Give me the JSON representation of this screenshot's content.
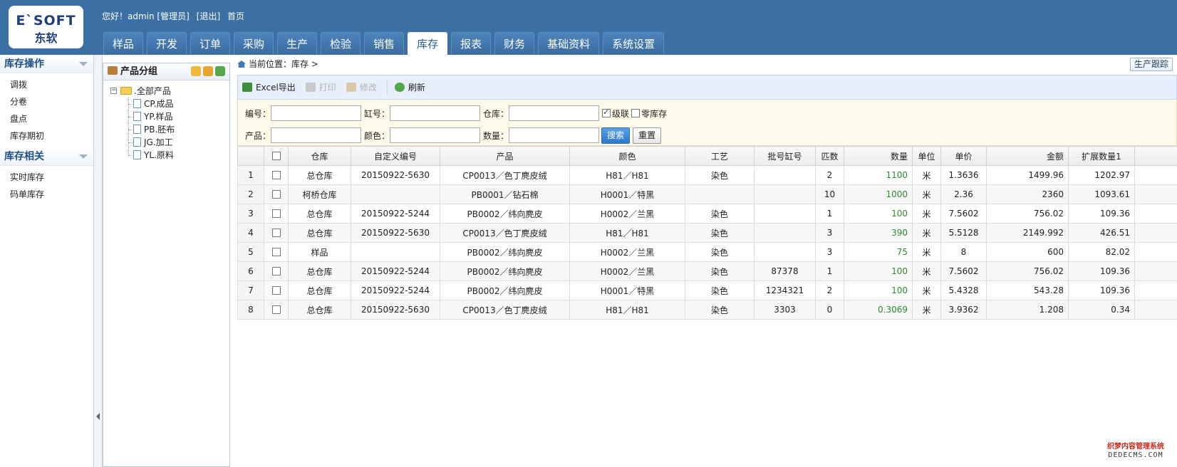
{
  "header": {
    "logo_en": "E`SOFT",
    "logo_cn": "东软",
    "greeting": "您好！admin [管理员]",
    "logout": "[退出]",
    "home": "首页",
    "tabs": [
      "样品",
      "开发",
      "订单",
      "采购",
      "生产",
      "检验",
      "销售",
      "库存",
      "报表",
      "财务",
      "基础资料",
      "系统设置"
    ],
    "active_tab": "库存"
  },
  "sidebar": {
    "section1_title": "库存操作",
    "section1_items": [
      "调拨",
      "分卷",
      "盘点",
      "库存期初"
    ],
    "section2_title": "库存相关",
    "section2_items": [
      "实时库存",
      "码单库存"
    ]
  },
  "tree": {
    "title": "产品分组",
    "root": ".全部产品",
    "children": [
      "CP.成品",
      "YP.样品",
      "PB.胚布",
      "JG.加工",
      "YL.原料"
    ]
  },
  "breadcrumb": {
    "text": "当前位置：库存 >",
    "track_button": "生产跟踪"
  },
  "toolbar": {
    "excel": "Excel导出",
    "print": "打印",
    "edit": "修改",
    "refresh": "刷新"
  },
  "search": {
    "code_label": "编号：",
    "vat_label": "缸号：",
    "warehouse_label": "仓库：",
    "cascade_label": "级联",
    "zero_stock_label": "零库存",
    "product_label": "产品：",
    "color_label": "颜色：",
    "qty_label": "数量：",
    "search_button": "搜索",
    "reset_button": "重置"
  },
  "table": {
    "columns": [
      "仓库",
      "自定义编号",
      "产品",
      "颜色",
      "工艺",
      "批号缸号",
      "匹数",
      "数量",
      "单位",
      "单价",
      "金额",
      "扩展数量1"
    ],
    "rows": [
      {
        "n": "1",
        "warehouse": "总仓库",
        "code": "20150922-5630",
        "product": "CP0013／色丁麂皮绒",
        "color": "H81／H81",
        "process": "染色",
        "batch": "",
        "pieces": "2",
        "qty": "1100",
        "unit": "米",
        "price": "1.3636",
        "amount": "1499.96",
        "ext1": "1202.97"
      },
      {
        "n": "2",
        "warehouse": "柯桥仓库",
        "code": "",
        "product": "PB0001／钻石棉",
        "color": "H0001／特黑",
        "process": "",
        "batch": "",
        "pieces": "10",
        "qty": "1000",
        "unit": "米",
        "price": "2.36",
        "amount": "2360",
        "ext1": "1093.61"
      },
      {
        "n": "3",
        "warehouse": "总仓库",
        "code": "20150922-5244",
        "product": "PB0002／纬向麂皮",
        "color": "H0002／兰黑",
        "process": "染色",
        "batch": "",
        "pieces": "1",
        "qty": "100",
        "unit": "米",
        "price": "7.5602",
        "amount": "756.02",
        "ext1": "109.36"
      },
      {
        "n": "4",
        "warehouse": "总仓库",
        "code": "20150922-5630",
        "product": "CP0013／色丁麂皮绒",
        "color": "H81／H81",
        "process": "染色",
        "batch": "",
        "pieces": "3",
        "qty": "390",
        "unit": "米",
        "price": "5.5128",
        "amount": "2149.992",
        "ext1": "426.51"
      },
      {
        "n": "5",
        "warehouse": "样品",
        "code": "",
        "product": "PB0002／纬向麂皮",
        "color": "H0002／兰黑",
        "process": "染色",
        "batch": "",
        "pieces": "3",
        "qty": "75",
        "unit": "米",
        "price": "8",
        "amount": "600",
        "ext1": "82.02"
      },
      {
        "n": "6",
        "warehouse": "总仓库",
        "code": "20150922-5244",
        "product": "PB0002／纬向麂皮",
        "color": "H0002／兰黑",
        "process": "染色",
        "batch": "87378",
        "pieces": "1",
        "qty": "100",
        "unit": "米",
        "price": "7.5602",
        "amount": "756.02",
        "ext1": "109.36"
      },
      {
        "n": "7",
        "warehouse": "总仓库",
        "code": "20150922-5244",
        "product": "PB0002／纬向麂皮",
        "color": "H0001／特黑",
        "process": "染色",
        "batch": "1234321",
        "pieces": "2",
        "qty": "100",
        "unit": "米",
        "price": "5.4328",
        "amount": "543.28",
        "ext1": "109.36"
      },
      {
        "n": "8",
        "warehouse": "总仓库",
        "code": "20150922-5630",
        "product": "CP0013／色丁麂皮绒",
        "color": "H81／H81",
        "process": "染色",
        "batch": "3303",
        "pieces": "0",
        "qty": "0.3069",
        "unit": "米",
        "price": "3.9362",
        "amount": "1.208",
        "ext1": "0.34"
      }
    ]
  },
  "watermark": {
    "line1": "织梦内容管理系统",
    "line2": "DEDECMS.COM"
  }
}
